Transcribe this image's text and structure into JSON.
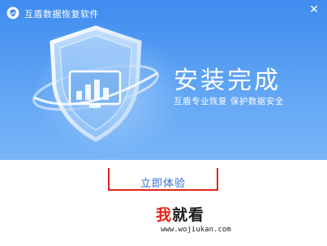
{
  "window": {
    "title": "互盾数据恢复软件",
    "close_glyph": "✕"
  },
  "banner": {
    "headline": "安装完成",
    "subtitle": "互盾专业恢复 保护数据安全"
  },
  "actions": {
    "start_label": "立即体验"
  },
  "watermark": {
    "part1": "我",
    "part2": "就看",
    "url": "www.wojiukan.com"
  },
  "colors": {
    "banner_top": "#3f8cef",
    "banner_bottom": "#79b6f8",
    "highlight_border": "#e0241b",
    "cta_text": "#2f6fd6"
  },
  "icons": [
    "shield-logo-icon",
    "close-icon",
    "shield-chart-icon"
  ]
}
